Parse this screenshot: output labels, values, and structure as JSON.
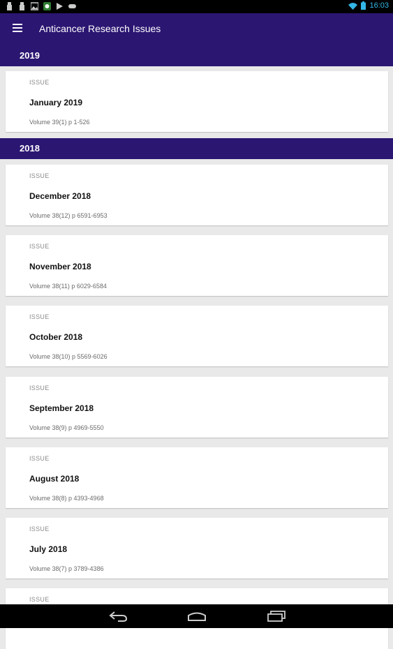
{
  "status_bar": {
    "time": "16:03"
  },
  "app_bar": {
    "title": "Anticancer Research Issues"
  },
  "sections": [
    {
      "year": "2019",
      "issues": [
        {
          "type": "ISSUE",
          "title": "January 2019",
          "meta": "Volume 39(1) p 1-526"
        }
      ]
    },
    {
      "year": "2018",
      "issues": [
        {
          "type": "ISSUE",
          "title": "December 2018",
          "meta": "Volume 38(12) p 6591-6953"
        },
        {
          "type": "ISSUE",
          "title": "November 2018",
          "meta": "Volume 38(11) p 6029-6584"
        },
        {
          "type": "ISSUE",
          "title": "October 2018",
          "meta": "Volume 38(10) p 5569-6026"
        },
        {
          "type": "ISSUE",
          "title": "September 2018",
          "meta": "Volume 38(9) p 4969-5550"
        },
        {
          "type": "ISSUE",
          "title": "August 2018",
          "meta": "Volume 38(8) p 4393-4968"
        },
        {
          "type": "ISSUE",
          "title": "July 2018",
          "meta": "Volume 38(7) p 3789-4386"
        },
        {
          "type": "ISSUE",
          "title": "",
          "meta": ""
        }
      ]
    }
  ],
  "icons": {
    "status_left": [
      "notification-icon",
      "notification-icon",
      "image-icon",
      "app-icon",
      "play-store-icon",
      "gamepad-icon"
    ],
    "status_right": [
      "wifi-icon",
      "battery-icon"
    ],
    "nav": [
      "back-icon",
      "home-icon",
      "recents-icon"
    ]
  },
  "colors": {
    "primary": "#2b1672",
    "accent": "#33b5e5"
  }
}
